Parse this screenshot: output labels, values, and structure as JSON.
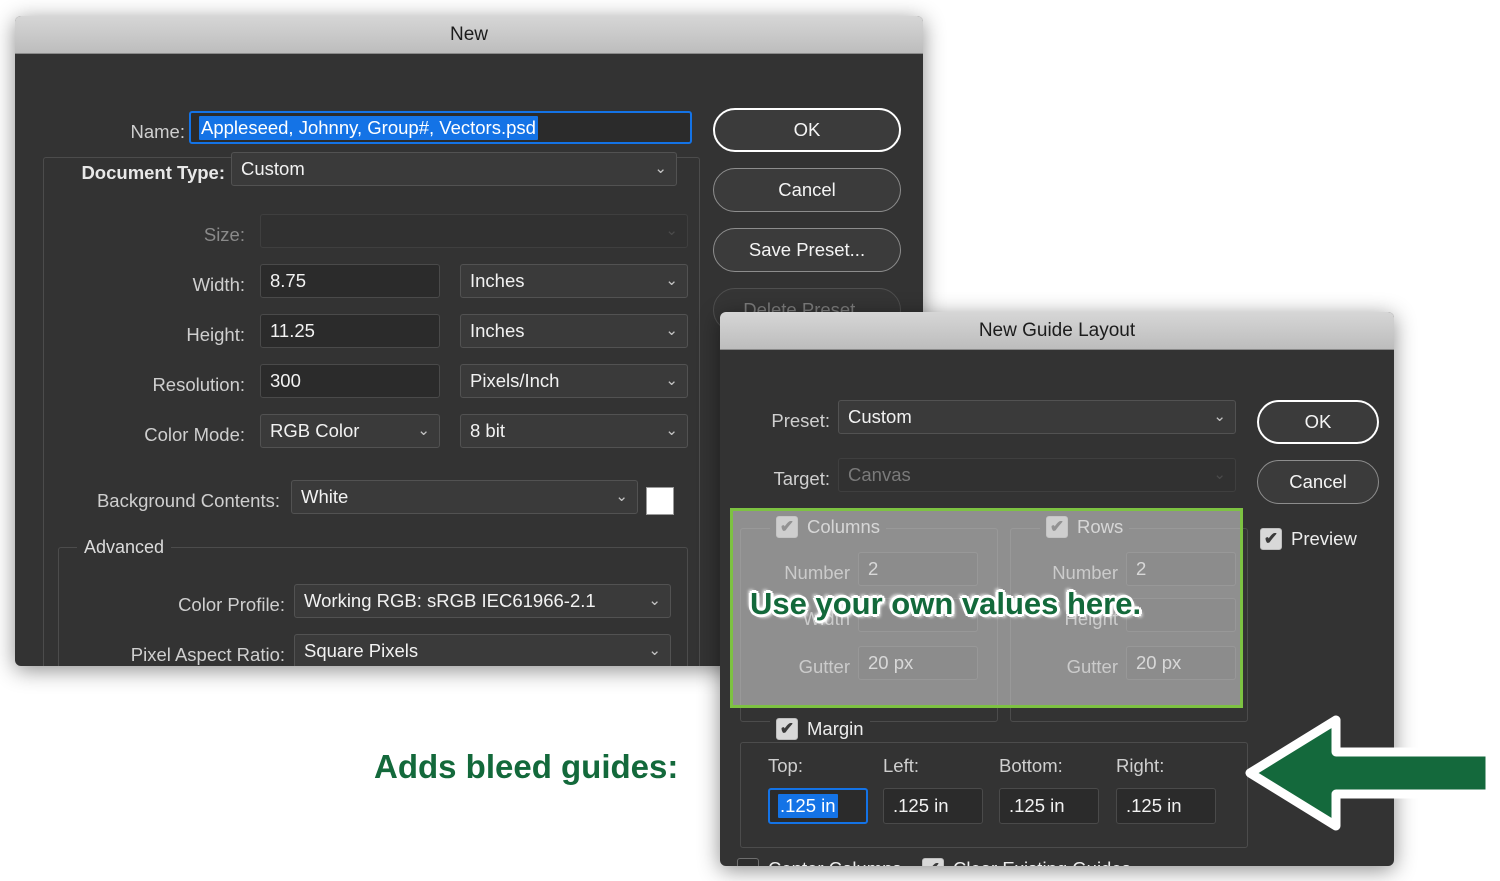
{
  "new_dialog": {
    "title": "New",
    "name_label": "Name:",
    "name_value": "Appleseed, Johnny, Group#, Vectors.psd",
    "doc_type_label": "Document Type:",
    "doc_type_value": "Custom",
    "size_label": "Size:",
    "size_value": "",
    "width_label": "Width:",
    "width_value": "8.75",
    "width_unit": "Inches",
    "height_label": "Height:",
    "height_value": "11.25",
    "height_unit": "Inches",
    "resolution_label": "Resolution:",
    "resolution_value": "300",
    "resolution_unit": "Pixels/Inch",
    "color_mode_label": "Color Mode:",
    "color_mode_value": "RGB Color",
    "color_depth_value": "8 bit",
    "background_label": "Background Contents:",
    "background_value": "White",
    "background_swatch_color": "#ffffff",
    "advanced_label": "Advanced",
    "color_profile_label": "Color Profile:",
    "color_profile_value": "Working RGB:  sRGB IEC61966-2.1",
    "pixel_aspect_label": "Pixel Aspect Ratio:",
    "pixel_aspect_value": "Square Pixels",
    "buttons": {
      "ok": "OK",
      "cancel": "Cancel",
      "save_preset": "Save Preset...",
      "delete_preset": "Delete Preset..."
    }
  },
  "guide_dialog": {
    "title": "New Guide Layout",
    "preset_label": "Preset:",
    "preset_value": "Custom",
    "target_label": "Target:",
    "target_value": "Canvas",
    "buttons": {
      "ok": "OK",
      "cancel": "Cancel"
    },
    "preview_label": "Preview",
    "columns": {
      "title": "Columns",
      "number_label": "Number",
      "number_value": "2",
      "width_label": "Width",
      "width_value": "",
      "gutter_label": "Gutter",
      "gutter_value": "20 px"
    },
    "rows": {
      "title": "Rows",
      "number_label": "Number",
      "number_value": "2",
      "height_label": "Height",
      "height_value": "",
      "gutter_label": "Gutter",
      "gutter_value": "20 px"
    },
    "margin": {
      "title": "Margin",
      "top_label": "Top:",
      "top_value": ".125 in",
      "left_label": "Left:",
      "left_value": ".125 in",
      "bottom_label": "Bottom:",
      "bottom_value": ".125 in",
      "right_label": "Right:",
      "right_value": ".125 in"
    },
    "center_columns_label": "Center Columns",
    "clear_guides_label": "Clear Existing Guides"
  },
  "annotations": {
    "values_note": "Use your own values here.",
    "bleed_note": "Adds bleed guides:",
    "accent_green": "#13693b",
    "highlight_green": "#7dc242",
    "selection_blue": "#1473e6"
  },
  "icons": {
    "chevron": "⌄",
    "check": "✔"
  }
}
